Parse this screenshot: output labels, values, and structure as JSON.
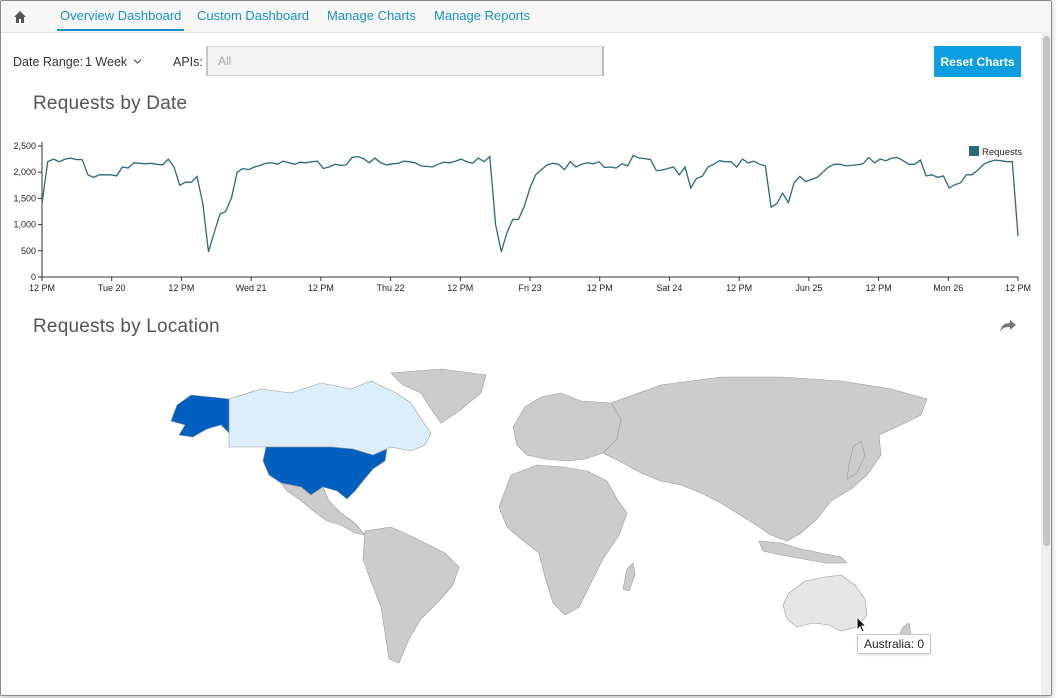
{
  "nav": {
    "home_icon": "home-icon",
    "tabs": [
      {
        "label": "Overview Dashboard",
        "active": true
      },
      {
        "label": "Custom Dashboard",
        "active": false
      },
      {
        "label": "Manage Charts",
        "active": false
      },
      {
        "label": "Manage Reports",
        "active": false
      }
    ]
  },
  "filters": {
    "date_range_label": "Date Range:",
    "date_range_value": "1 Week",
    "apis_label": "APIs:",
    "apis_placeholder": "All"
  },
  "reset_button": "Reset Charts",
  "requests_by_date": {
    "title": "Requests by Date"
  },
  "requests_by_location": {
    "title": "Requests by Location",
    "share_icon": "share-arrow-icon",
    "tooltip": "Australia: 0"
  },
  "colors": {
    "accent": "#1a8fc6",
    "button": "#0e9ee2",
    "line": "#2a6a7e",
    "map_high": "#005fbf",
    "map_low": "#ddeefb",
    "map_none": "#cccccc"
  },
  "chart_data": {
    "type": "line",
    "ylim": [
      0,
      2500
    ],
    "yticks": [
      "0",
      "500",
      "1,000",
      "1,500",
      "2,000",
      "2,500"
    ],
    "xticks": [
      "12 PM",
      "Tue 20",
      "12 PM",
      "Wed 21",
      "12 PM",
      "Thu 22",
      "12 PM",
      "Fri 23",
      "12 PM",
      "Sat 24",
      "12 PM",
      "Jun 25",
      "12 PM",
      "Mon 26",
      "12 PM"
    ],
    "legend": "top-right",
    "series": [
      {
        "name": "Requests",
        "values": [
          1400,
          2200,
          2250,
          2200,
          2250,
          2270,
          2240,
          2240,
          1950,
          1900,
          1950,
          1950,
          1950,
          1930,
          2100,
          2080,
          2180,
          2170,
          2160,
          2170,
          2150,
          2140,
          2250,
          2100,
          1750,
          1810,
          1810,
          1920,
          1400,
          480,
          850,
          1200,
          1250,
          1510,
          2000,
          2070,
          2050,
          2100,
          2130,
          2170,
          2180,
          2150,
          2210,
          2180,
          2150,
          2190,
          2180,
          2200,
          2210,
          2070,
          2100,
          2150,
          2130,
          2140,
          2280,
          2300,
          2260,
          2180,
          2270,
          2180,
          2140,
          2160,
          2170,
          2210,
          2200,
          2180,
          2120,
          2110,
          2100,
          2150,
          2190,
          2180,
          2210,
          2250,
          2200,
          2170,
          2270,
          2200,
          2300,
          1000,
          480,
          850,
          1100,
          1100,
          1350,
          1700,
          1950,
          2050,
          2140,
          2170,
          2150,
          2050,
          2200,
          2100,
          2150,
          2180,
          2160,
          2200,
          2090,
          2100,
          2080,
          2160,
          2120,
          2320,
          2270,
          2260,
          2240,
          2030,
          2040,
          2070,
          2100,
          1950,
          2100,
          1700,
          1880,
          1920,
          2100,
          2150,
          2220,
          2200,
          2200,
          2100,
          2250,
          2180,
          2210,
          2150,
          2120,
          1330,
          1400,
          1600,
          1420,
          1800,
          1920,
          1820,
          1860,
          1900,
          2000,
          2100,
          2150,
          2150,
          2120,
          2130,
          2140,
          2160,
          2280,
          2180,
          2250,
          2220,
          2270,
          2280,
          2220,
          2150,
          2150,
          2230,
          1930,
          1950,
          1900,
          1930,
          1700,
          1760,
          1800,
          1950,
          1950,
          2040,
          2150,
          2200,
          2230,
          2220,
          2200,
          2200,
          780
        ]
      }
    ]
  }
}
